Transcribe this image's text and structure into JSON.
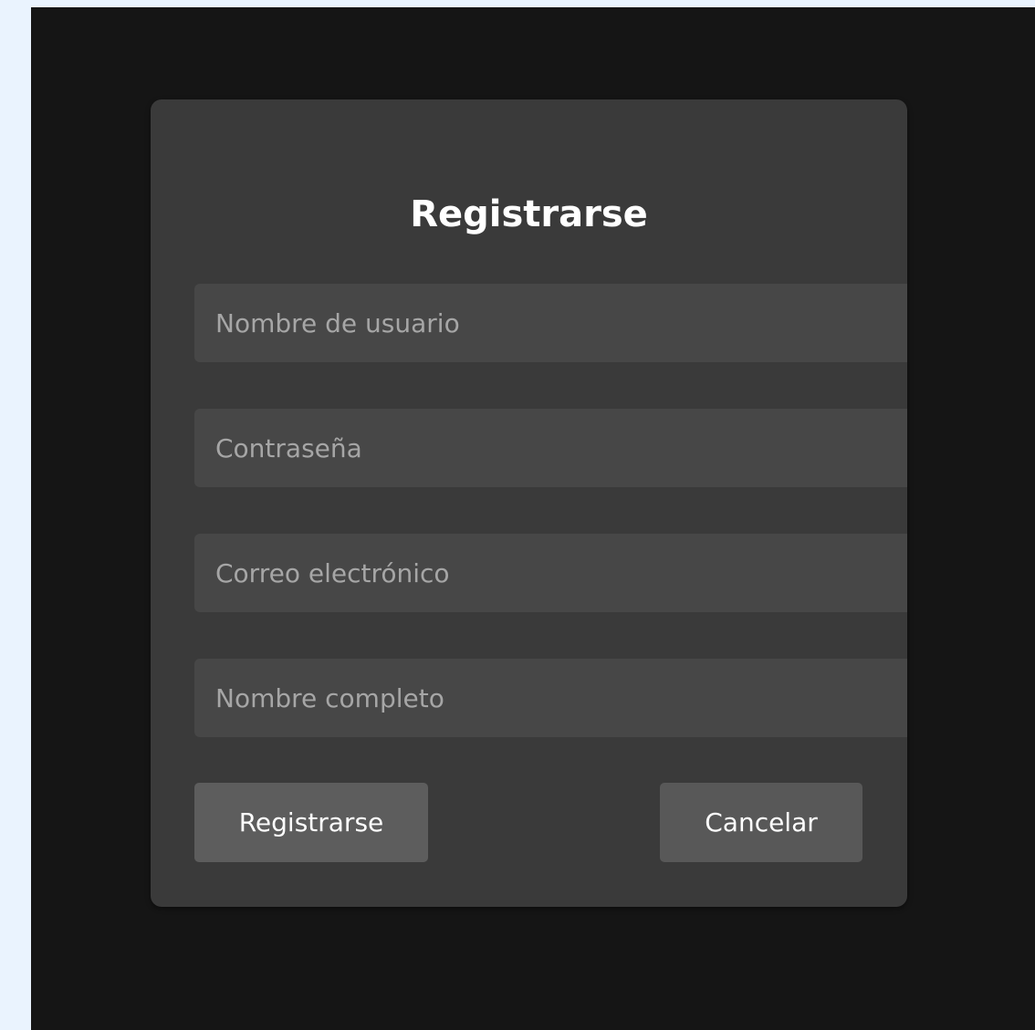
{
  "form": {
    "title": "Registrarse",
    "fields": {
      "username": {
        "placeholder": "Nombre de usuario",
        "value": ""
      },
      "password": {
        "placeholder": "Contraseña",
        "value": ""
      },
      "email": {
        "placeholder": "Correo electrónico",
        "value": ""
      },
      "full_name": {
        "placeholder": "Nombre completo",
        "value": ""
      }
    },
    "buttons": {
      "register_label": "Registrarse",
      "cancel_label": "Cancelar"
    }
  },
  "colors": {
    "page_background": "#eaf3fe",
    "window_background": "#151515",
    "card_background": "#3a3a3a",
    "input_background": "#474747",
    "button_background": "#5d5d5d",
    "placeholder_text": "#a6a6a6",
    "title_text": "#ffffff"
  }
}
